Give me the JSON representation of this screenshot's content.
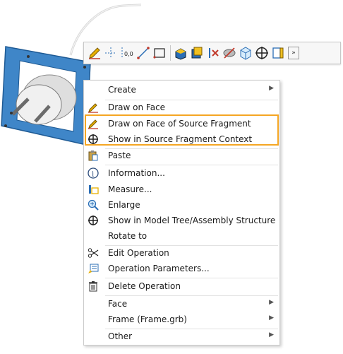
{
  "toolbar": {
    "icons": [
      "draw-pencil-icon",
      "crosshair-dashed-icon",
      "dimension-icon",
      "line-segment-icon",
      "rectangle-icon",
      "extrude-icon",
      "face-select-icon",
      "delete-x-icon",
      "hide-icon",
      "cube-view-icon",
      "target-icon",
      "measure-icon",
      "more-icon"
    ],
    "more_label": "»"
  },
  "menu": {
    "create": "Create",
    "draw_on_face": "Draw on Face",
    "draw_on_face_source": "Draw on Face of Source Fragment",
    "show_in_source": "Show in Source Fragment Context",
    "paste": "Paste",
    "information": "Information...",
    "measure": "Measure...",
    "enlarge": "Enlarge",
    "show_in_model_tree": "Show in Model Tree/Assembly Structure",
    "rotate_to": "Rotate to",
    "edit_operation": "Edit Operation",
    "operation_parameters": "Operation Parameters...",
    "delete_operation": "Delete Operation",
    "face": "Face",
    "frame": "Frame (Frame.grb)",
    "other": "Other"
  },
  "colors": {
    "highlight_border": "#f5a623",
    "frame_blue": "#3f86c8",
    "pencil_yellow": "#e8b000",
    "accent_blue": "#2a6db5"
  }
}
